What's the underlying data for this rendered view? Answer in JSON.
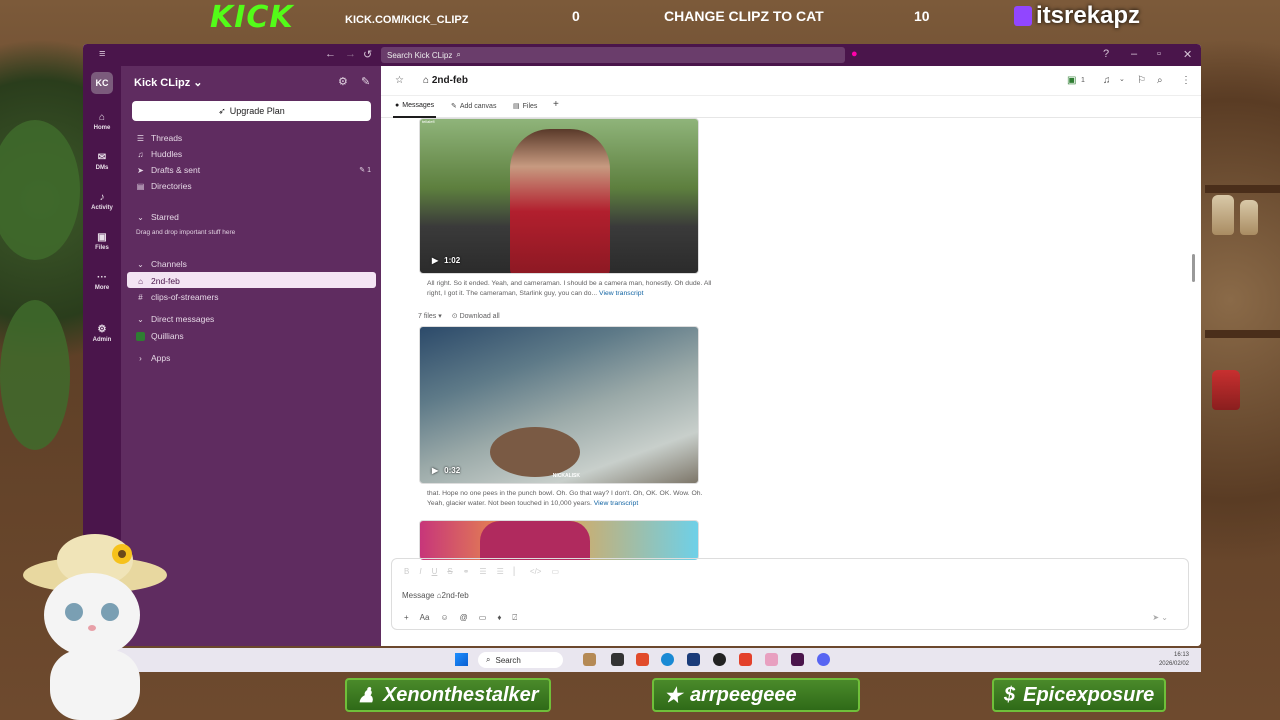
{
  "overlay": {
    "kick_logo": "KICK",
    "kick_url": "KICK.COM/KICK_CLIPZ",
    "score_left": "0",
    "score_title": "CHANGE CLIPZ TO CAT",
    "score_right": "10",
    "twitch_handle": "itsrekapz",
    "badges": [
      "Xenonthestalker",
      "arrpeegeee",
      "Epicexposure"
    ],
    "badge_icons": [
      "person-icon",
      "star-icon",
      "dollar-icon"
    ]
  },
  "window": {
    "search_placeholder": "Search Kick CLipz"
  },
  "rail": {
    "workspace_initials": "KC",
    "items": [
      {
        "label": "Home",
        "icon": "home-icon"
      },
      {
        "label": "DMs",
        "icon": "dms-icon"
      },
      {
        "label": "Activity",
        "icon": "bell-icon"
      },
      {
        "label": "Files",
        "icon": "files-icon"
      },
      {
        "label": "More",
        "icon": "more-icon"
      },
      {
        "label": "Admin",
        "icon": "gear-icon"
      }
    ]
  },
  "sidebar": {
    "workspace_name": "Kick CLipz",
    "upgrade_label": "Upgrade Plan",
    "nav": [
      {
        "label": "Threads"
      },
      {
        "label": "Huddles"
      },
      {
        "label": "Drafts & sent",
        "count": "1"
      },
      {
        "label": "Directories"
      }
    ],
    "starred_label": "Starred",
    "starred_hint": "Drag and drop important stuff here",
    "channels_label": "Channels",
    "channels": [
      "2nd-feb",
      "clips-of-streamers"
    ],
    "dm_label": "Direct messages",
    "dms": [
      "Quillians"
    ],
    "apps_label": "Apps"
  },
  "channel": {
    "name": "2nd-feb",
    "member_count": "1",
    "tabs": [
      "Messages",
      "Add canvas",
      "Files"
    ],
    "top_watermark": "tellalefl"
  },
  "messages": [
    {
      "duration": "1:02",
      "caption": "All right. So it ended. Yeah, and cameraman. I should be a camera man, honestly. Oh dude. All right, I got it. The cameraman, Starlink guy, you can do...",
      "link": "View transcript"
    },
    {
      "files_label": "7 files",
      "download_label": "Download all",
      "duration": "0:32",
      "watermark": "NICKALISK",
      "caption": "that. Hope no one pees in the punch bowl. Oh. Go that way? I don't. Oh, OK. OK. Wow. Oh. Yeah, glacier water. Not been touched in 10,000 years.",
      "link": "View transcript"
    }
  ],
  "composer": {
    "placeholder": "Message ⌂2nd-feb"
  },
  "taskbar": {
    "search_label": "Search",
    "time": "16:13",
    "date": "2026/02/02"
  }
}
